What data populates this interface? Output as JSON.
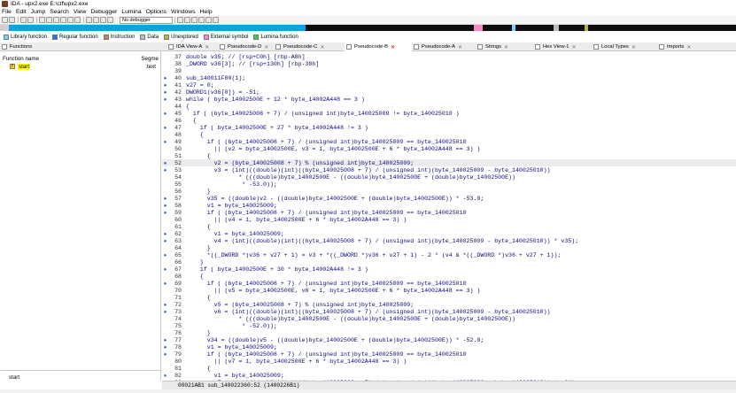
{
  "window": {
    "title": "IDA - upx2.exe E:\\ctf\\upx2.exe"
  },
  "menu": [
    "File",
    "Edit",
    "Jump",
    "Search",
    "View",
    "Debugger",
    "Lumina",
    "Options",
    "Windows",
    "Help"
  ],
  "toolbar": {
    "debugger_select": "No debugger"
  },
  "legend": [
    {
      "label": "Library function",
      "color": "#7fd0ff"
    },
    {
      "label": "Regular function",
      "color": "#2a6ee8"
    },
    {
      "label": "Instruction",
      "color": "#c87e5a"
    },
    {
      "label": "Data",
      "color": "#c0c0c0"
    },
    {
      "label": "Unexplored",
      "color": "#b8b048"
    },
    {
      "label": "External symbol",
      "color": "#ff88cc"
    },
    {
      "label": "Lumina function",
      "color": "#44c844"
    }
  ],
  "tabs": [
    "IDA View-A",
    "Pseudocode-D",
    "Pseudocode-C",
    "Pseudocode-B",
    "Pseudocode-A",
    "Strings",
    "Hex View-1",
    "Local Types",
    "Imports"
  ],
  "functions_panel": {
    "title": "Functions",
    "col_name": "Function name",
    "col_segment": "Segme",
    "rows": [
      {
        "name": "start",
        "segment": ".text"
      }
    ]
  },
  "graph_panel": {
    "label": "start"
  },
  "code_lines": [
    {
      "n": "37",
      "dot": false,
      "text": "double v35; // [rsp+C0h] [rbp-A8h]"
    },
    {
      "n": "38",
      "dot": false,
      "text": "_DWORD v36[3]; // [rsp+130h] [rbp-38h]"
    },
    {
      "n": "39",
      "dot": false,
      "text": ""
    },
    {
      "n": "40",
      "dot": true,
      "text": "sub_140011F80(1);"
    },
    {
      "n": "41",
      "dot": true,
      "text": "v27 = 0;"
    },
    {
      "n": "42",
      "dot": true,
      "text": "DWORD1(v36[0]) = -51;"
    },
    {
      "n": "43",
      "dot": true,
      "text": "while ( byte_14002500E + 12 * byte_14002A448 == 3 )"
    },
    {
      "n": "44",
      "dot": false,
      "text": "{"
    },
    {
      "n": "45",
      "dot": true,
      "text": "  if ( (byte_140025008 + 7) / (unsigned int)byte_140025009 != byte_140025010 )"
    },
    {
      "n": "46",
      "dot": false,
      "text": "  {"
    },
    {
      "n": "47",
      "dot": true,
      "text": "    if ( byte_14002500E + 27 * byte_14002A448 != 3 )"
    },
    {
      "n": "48",
      "dot": false,
      "text": "    {"
    },
    {
      "n": "49",
      "dot": true,
      "text": "      if ( (byte_140025008 + 7) / (unsigned int)byte_140025009 == byte_140025010"
    },
    {
      "n": "50",
      "dot": false,
      "text": "        || (v2 = byte_14002500E, v3 = 1, byte_14002500E + 6 * byte_14002A448 == 3) )"
    },
    {
      "n": "51",
      "dot": false,
      "text": "      {"
    },
    {
      "n": "52",
      "dot": true,
      "text": "        v2 = (byte_140025008 + 7) % (unsigned int)byte_140025009;",
      "hl": true
    },
    {
      "n": "53",
      "dot": true,
      "text": "        v3 = (int)((double)(int)((byte_140025008 + 7) / (unsigned int)(byte_140025009 - byte_140025010))"
    },
    {
      "n": "54",
      "dot": false,
      "text": "               * (((double)byte_14002500E - ((double)byte_14002500E + (double)byte_14002500E))"
    },
    {
      "n": "55",
      "dot": false,
      "text": "                * -53.0));"
    },
    {
      "n": "56",
      "dot": false,
      "text": "      }"
    },
    {
      "n": "57",
      "dot": true,
      "text": "      v35 = ((double)v2 - ((double)byte_14002500E + (double)byte_14002500E)) * -53.0;"
    },
    {
      "n": "58",
      "dot": true,
      "text": "      v1 = byte_140025009;"
    },
    {
      "n": "59",
      "dot": true,
      "text": "      if ( (byte_140025008 + 7) / (unsigned int)byte_140025009 == byte_140025010"
    },
    {
      "n": "60",
      "dot": false,
      "text": "        || (v4 = 1, byte_14002500E + 6 * byte_14002A448 == 3) )"
    },
    {
      "n": "61",
      "dot": false,
      "text": "      {"
    },
    {
      "n": "62",
      "dot": true,
      "text": "        v1 = byte_140025009;"
    },
    {
      "n": "63",
      "dot": true,
      "text": "        v4 = (int)((double)(int)((byte_140025008 + 7) / (unsigned int)(byte_140025009 - byte_140025010)) * v35);"
    },
    {
      "n": "64",
      "dot": false,
      "text": "      }"
    },
    {
      "n": "65",
      "dot": true,
      "text": "      *((_DWORD *)v36 + v27 + 1) = v3 + *((_DWORD *)v36 + v27 + 1) - 2 * (v4 & *((_DWORD *)v36 + v27 + 1));"
    },
    {
      "n": "66",
      "dot": false,
      "text": "    }"
    },
    {
      "n": "67",
      "dot": true,
      "text": "    if ( byte_14002500E + 30 * byte_14002A448 != 3 )"
    },
    {
      "n": "68",
      "dot": false,
      "text": "    {"
    },
    {
      "n": "69",
      "dot": true,
      "text": "      if ( (byte_140025008 + 7) / (unsigned int)byte_140025009 == byte_140025010"
    },
    {
      "n": "70",
      "dot": false,
      "text": "        || (v5 = byte_14002500E, v6 = 1, byte_14002500E + 6 * byte_14002A448 == 3) )"
    },
    {
      "n": "71",
      "dot": false,
      "text": "      {"
    },
    {
      "n": "72",
      "dot": true,
      "text": "        v5 = (byte_140025008 + 7) % (unsigned int)byte_140025009;"
    },
    {
      "n": "73",
      "dot": true,
      "text": "        v6 = (int)((double)(int)((byte_140025008 + 7) / (unsigned int)(byte_140025009 - byte_140025010))"
    },
    {
      "n": "74",
      "dot": false,
      "text": "               * (((double)byte_14002500E - ((double)byte_14002500E + (double)byte_14002500E))"
    },
    {
      "n": "75",
      "dot": false,
      "text": "                * -52.0));"
    },
    {
      "n": "76",
      "dot": false,
      "text": "      }"
    },
    {
      "n": "77",
      "dot": true,
      "text": "      v34 = ((double)v5 - ((double)byte_14002500E + (double)byte_14002500E)) * -52.0;"
    },
    {
      "n": "78",
      "dot": true,
      "text": "      v1 = byte_140025009;"
    },
    {
      "n": "79",
      "dot": true,
      "text": "      if ( (byte_140025008 + 7) / (unsigned int)byte_140025009 == byte_140025010"
    },
    {
      "n": "80",
      "dot": false,
      "text": "        || (v7 = 1, byte_14002500E + 6 * byte_14002A448 == 3) )"
    },
    {
      "n": "81",
      "dot": false,
      "text": "      {"
    },
    {
      "n": "82",
      "dot": true,
      "text": "        v1 = byte_140025009;"
    },
    {
      "n": "83",
      "dot": true,
      "text": "        v7 = (int)((double)(int)((byte_140025008 + 7) / (unsigned int)(byte_140025009 - byte_140025010)) * v34);"
    }
  ],
  "status": "00021AB1 sub_140022360:52 (1400226B1)"
}
